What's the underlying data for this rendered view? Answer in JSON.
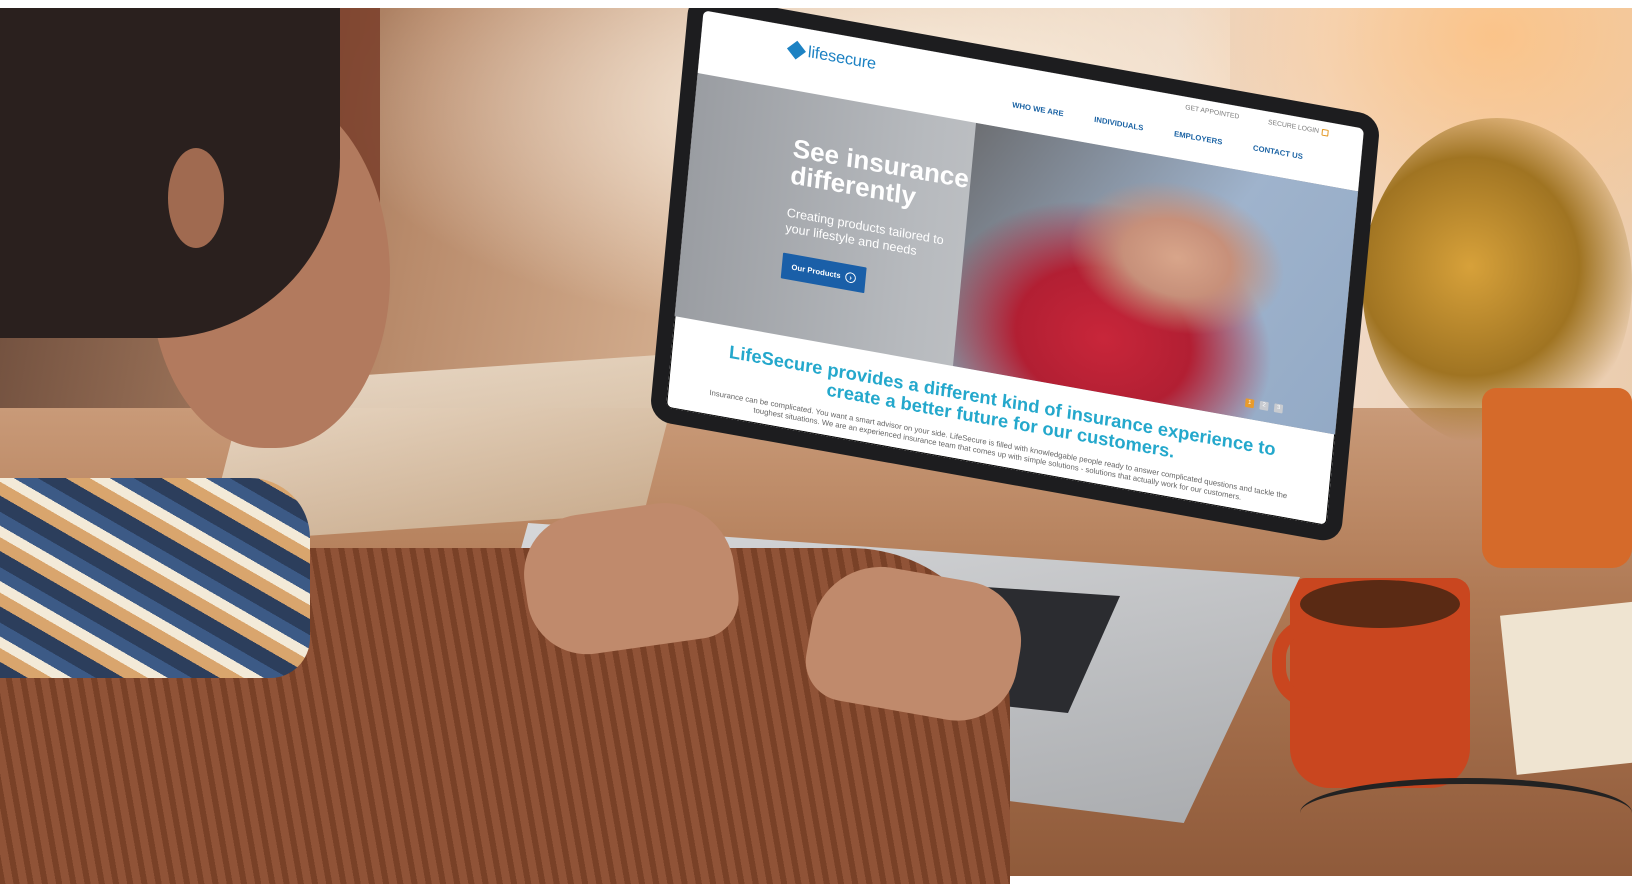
{
  "website": {
    "logo_text": "lifesecure",
    "top_nav": [
      "GET APPOINTED",
      "SECURE LOGIN"
    ],
    "main_nav": [
      "WHO WE ARE",
      "INDIVIDUALS",
      "EMPLOYERS",
      "CONTACT US"
    ],
    "hero": {
      "title": "See insurance differently",
      "subtitle": "Creating products tailored to your lifestyle and needs",
      "button_label": "Our Products",
      "slide_indicators": [
        "1",
        "2",
        "3"
      ],
      "active_slide": "1"
    },
    "intro": {
      "title": "LifeSecure provides a different kind of insurance experience to create a better future for our customers.",
      "body": "Insurance can be complicated. You want a smart advisor on your side. LifeSecure is filled with knowledgable people ready to answer complicated questions and tackle the toughest situations. We are an experienced insurance team that comes up with simple solutions - solutions that actually work for our customers."
    }
  },
  "colors": {
    "brand_blue": "#1d82c3",
    "nav_blue": "#1b63a4",
    "headline_teal": "#24a8cc",
    "accent_orange": "#e89b2c"
  }
}
